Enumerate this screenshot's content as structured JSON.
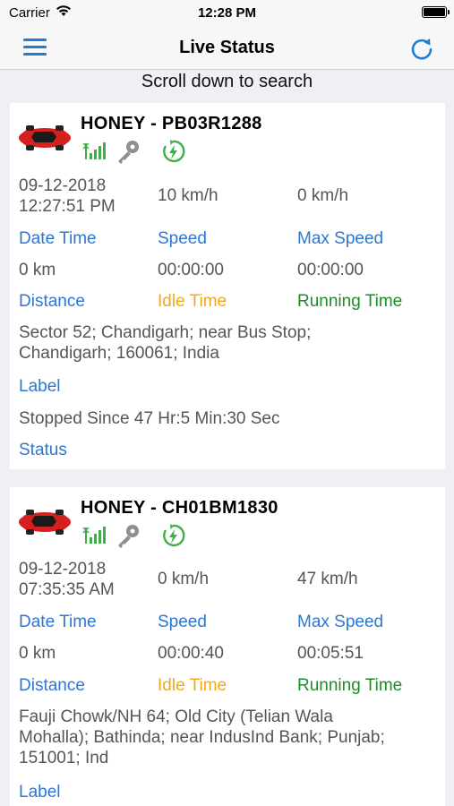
{
  "status_bar": {
    "carrier": "Carrier",
    "time": "12:28 PM"
  },
  "nav": {
    "title": "Live Status",
    "menu_icon": "hamburger-menu-icon",
    "refresh_icon": "refresh-icon"
  },
  "search_hint": "Scroll down to search",
  "labels": {
    "date_time": "Date Time",
    "speed": "Speed",
    "max_speed": "Max Speed",
    "distance": "Distance",
    "idle_time": "Idle Time",
    "running_time": "Running Time",
    "label": "Label",
    "status": "Status"
  },
  "colors": {
    "accent_blue": "#2d76d2",
    "idle_orange": "#f0a81c",
    "running_green": "#1f8a2a",
    "car_red": "#d81f1f"
  },
  "vehicles": [
    {
      "name": "HONEY - PB03R1288",
      "date": "09-12-2018",
      "time": "12:27:51 PM",
      "speed": "10 km/h",
      "max_speed": "0 km/h",
      "distance": "0 km",
      "idle_time": "00:00:00",
      "running_time": "00:00:00",
      "address_line1": "Sector 52; Chandigarh; near Bus Stop;",
      "address_line2": "Chandigarh; 160061; India",
      "status_text": "Stopped Since 47 Hr:5 Min:30 Sec"
    },
    {
      "name": "HONEY - CH01BM1830",
      "date": "09-12-2018",
      "time": "07:35:35 AM",
      "speed": "0 km/h",
      "max_speed": "47 km/h",
      "distance": "0 km",
      "idle_time": "00:00:40",
      "running_time": "00:05:51",
      "address_line1": "Fauji Chowk/NH 64; Old City (Telian Wala",
      "address_line2": "Mohalla); Bathinda; near IndusInd Bank; Punjab;",
      "address_line3": "151001; Ind"
    }
  ]
}
